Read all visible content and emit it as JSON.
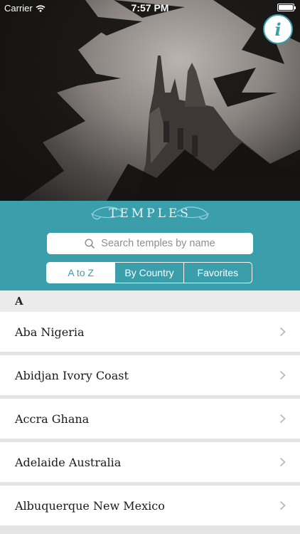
{
  "status_bar": {
    "carrier": "Carrier",
    "time": "7:57 PM",
    "battery": 1.0
  },
  "header": {
    "brand": "TEMPLES",
    "search": {
      "placeholder": "Search temples by name"
    },
    "segments": [
      {
        "label": "A to Z",
        "active": true
      },
      {
        "label": "By Country",
        "active": false
      },
      {
        "label": "Favorites",
        "active": false
      }
    ]
  },
  "info_button": {
    "icon": "info-icon"
  },
  "list": {
    "section_letter": "A",
    "items": [
      {
        "name": "Aba Nigeria"
      },
      {
        "name": "Abidjan Ivory Coast"
      },
      {
        "name": "Accra Ghana"
      },
      {
        "name": "Adelaide Australia"
      },
      {
        "name": "Albuquerque New Mexico"
      }
    ]
  },
  "colors": {
    "accent": "#3a9eab",
    "background": "#e4e4e4",
    "text": "#1a1a1a"
  }
}
